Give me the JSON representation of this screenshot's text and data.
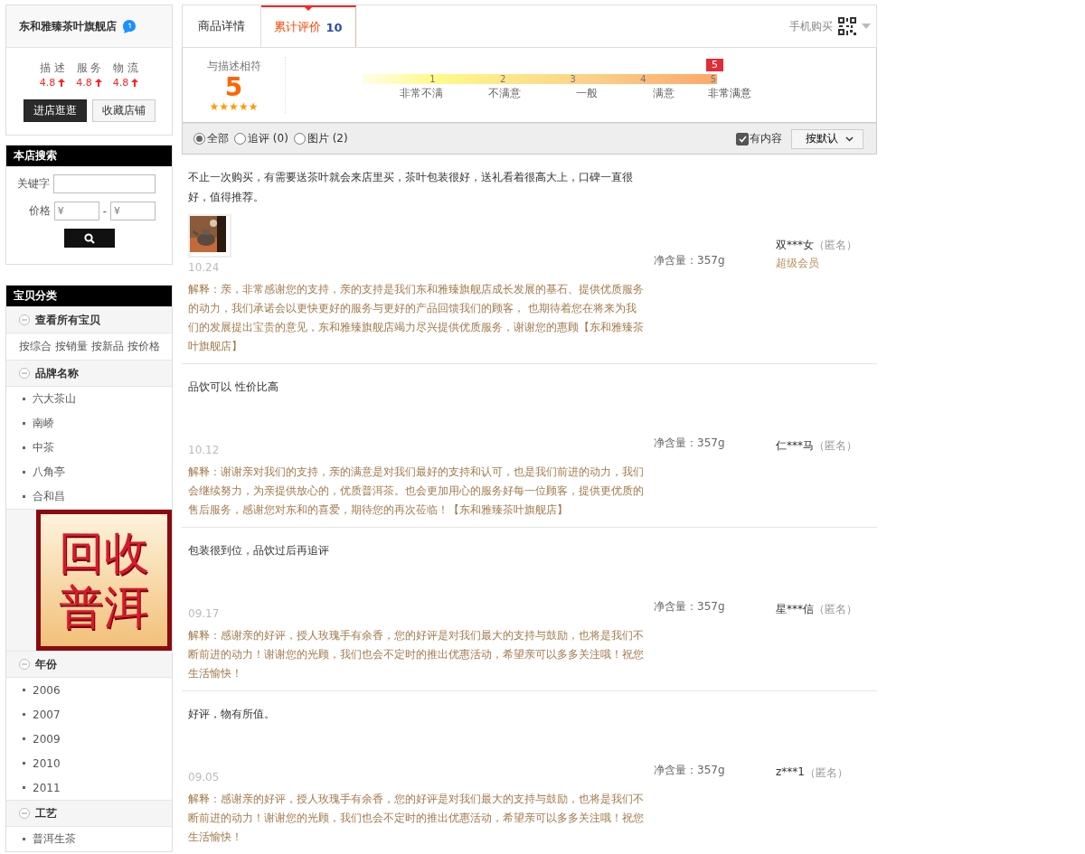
{
  "shop": {
    "name": "东和雅臻茶叶旗舰店",
    "ratings": [
      {
        "label": "描 述",
        "value": "4.8"
      },
      {
        "label": "服 务",
        "value": "4.8"
      },
      {
        "label": "物 流",
        "value": "4.8"
      }
    ],
    "buttons": [
      {
        "label": "进店逛逛",
        "kind": "primary"
      },
      {
        "label": "收藏店铺",
        "kind": "secondary"
      }
    ]
  },
  "search": {
    "title": "本店搜索",
    "keyword_label": "关键字",
    "price_label": "价格",
    "price_min_placeholder": "¥",
    "price_separator": "-",
    "price_max_placeholder": "¥"
  },
  "categories": {
    "title": "宝贝分类",
    "groups": [
      {
        "title": "查看所有宝贝",
        "expanded": true,
        "links": [
          "按综合",
          "按销量",
          "按新品",
          "按价格"
        ]
      },
      {
        "title": "品牌名称",
        "expanded": true,
        "items": [
          "六大茶山",
          "南峤",
          "中茶",
          "八角亭",
          "合和昌"
        ],
        "banner": [
          "回收",
          "普洱"
        ]
      },
      {
        "title": "年份",
        "expanded": true,
        "items": [
          "2006",
          "2007",
          "2009",
          "2010",
          "2011"
        ]
      },
      {
        "title": "工艺",
        "expanded": true,
        "items": [
          "普洱生茶"
        ]
      }
    ]
  },
  "tabs": [
    {
      "label": "商品详情",
      "selected": false
    },
    {
      "label": "累计评价",
      "count": "10",
      "selected": true
    }
  ],
  "mobile_buy": "手机购买",
  "summary": {
    "label": "与描述相符",
    "score": "5",
    "stars": 5,
    "marker": "5",
    "scale": [
      {
        "number": "1",
        "label": "非常不满",
        "selected": false
      },
      {
        "number": "2",
        "label": "不满意",
        "selected": false
      },
      {
        "number": "3",
        "label": "一般",
        "selected": false
      },
      {
        "number": "4",
        "label": "满意",
        "selected": false
      },
      {
        "number": "5",
        "label": "非常满意",
        "selected": true
      }
    ]
  },
  "filters": [
    {
      "label": "全部",
      "selected": true
    },
    {
      "label": "追评 (0)",
      "selected": false
    },
    {
      "label": "图片 (2)",
      "selected": false
    }
  ],
  "has_content": {
    "label": "有内容",
    "checked": true
  },
  "sort": "按默认",
  "reviews": [
    {
      "text": "不止一次购买，有需要送茶叶就会来店里买，茶叶包装很好，送礼看着很高大上，口碑一直很好，值得推荐。",
      "date": "10.24",
      "spec": "净含量：357g",
      "user": "双***女",
      "anon": "（匿名）",
      "member": "超级会员",
      "reply": "解释：亲，非常感谢您的支持，亲的支持是我们东和雅臻旗舰店成长发展的基石、提供优质服务的动力，我们承诺会以更快更好的服务与更好的产品回馈我们的顾客， 也期待着您在将来为我们的发展提出宝贵的意见，东和雅臻旗舰店竭力尽兴提供优质服务，谢谢您的惠顾【东和雅臻茶叶旗舰店】"
    },
    {
      "text": "品饮可以 性价比高",
      "date": "10.12",
      "spec": "净含量：357g",
      "user": "仁***马",
      "anon": "（匿名）",
      "reply": "解释：谢谢亲对我们的支持，亲的满意是对我们最好的支持和认可，也是我们前进的动力，我们会继续努力，为亲提供放心的，优质普洱茶。也会更加用心的服务好每一位顾客，提供更优质的售后服务，感谢您对东和的喜爱，期待您的再次莅临！【东和雅臻茶叶旗舰店】"
    },
    {
      "text": "包装很到位，品饮过后再追评",
      "date": "09.17",
      "spec": "净含量：357g",
      "user": "星***信",
      "anon": "（匿名）",
      "reply": "解释：感谢亲的好评，授人玫瑰手有余香，您的好评是对我们最大的支持与鼓励，也将是我们不断前进的动力！谢谢您的光顾，我们也会不定时的推出优惠活动，希望亲可以多多关注哦！祝您生活愉快！"
    },
    {
      "text": "好评，物有所值。",
      "date": "09.05",
      "spec": "净含量：357g",
      "user": "z***1",
      "anon": "（匿名）",
      "reply": "解释：感谢亲的好评，授人玫瑰手有余香，您的好评是对我们最大的支持与鼓励，也将是我们不断前进的动力！谢谢您的光顾，我们也会不定时的推出优惠活动，希望亲可以多多关注哦！祝您生活愉快！"
    }
  ]
}
